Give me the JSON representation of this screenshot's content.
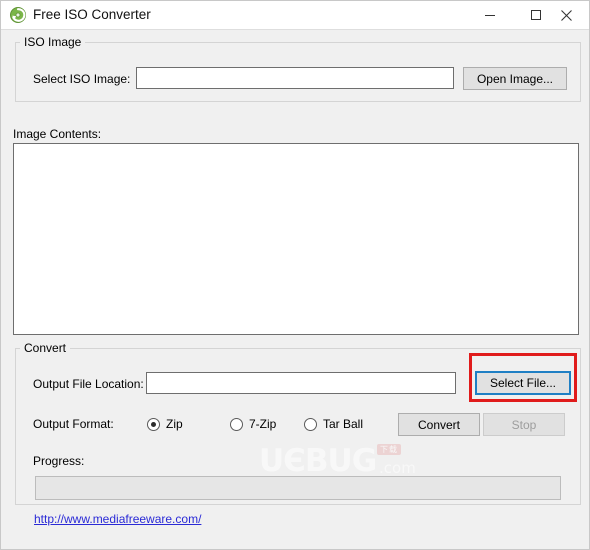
{
  "window": {
    "title": "Free ISO Converter",
    "icon": "app-disc-icon",
    "minimize_label": "—",
    "maximize_label": "☐",
    "close_label": "✕"
  },
  "iso_group": {
    "legend": "ISO Image",
    "select_label": "Select ISO Image:",
    "path_value": "",
    "path_placeholder": "",
    "open_button": "Open Image..."
  },
  "contents": {
    "label": "Image Contents:",
    "items": []
  },
  "convert_group": {
    "legend": "Convert",
    "output_label": "Output File Location:",
    "output_value": "",
    "output_placeholder": "",
    "select_file_button": "Select File...",
    "format_label": "Output Format:",
    "formats": [
      {
        "label": "Zip",
        "checked": true
      },
      {
        "label": "7-Zip",
        "checked": false
      },
      {
        "label": "Tar Ball",
        "checked": false
      }
    ],
    "convert_button": "Convert",
    "stop_button": "Stop",
    "stop_disabled": true,
    "progress_label": "Progress:",
    "progress_percent": 0
  },
  "footer": {
    "link_text": "http://www.mediafreeware.com/"
  },
  "watermark": {
    "text": "UЄBUG",
    "badge": "下载",
    "suffix": ".com"
  },
  "colors": {
    "window_background": "#f0f0f0",
    "titlebar_background": "#ffffff",
    "annotation_red": "#e01b1b",
    "focus_blue": "#1f7fc4",
    "link_blue": "#2a2ad6",
    "textbox_border": "#6e6e6e",
    "button_face": "#e1e1e1",
    "disabled_text": "#9d9d9d"
  }
}
